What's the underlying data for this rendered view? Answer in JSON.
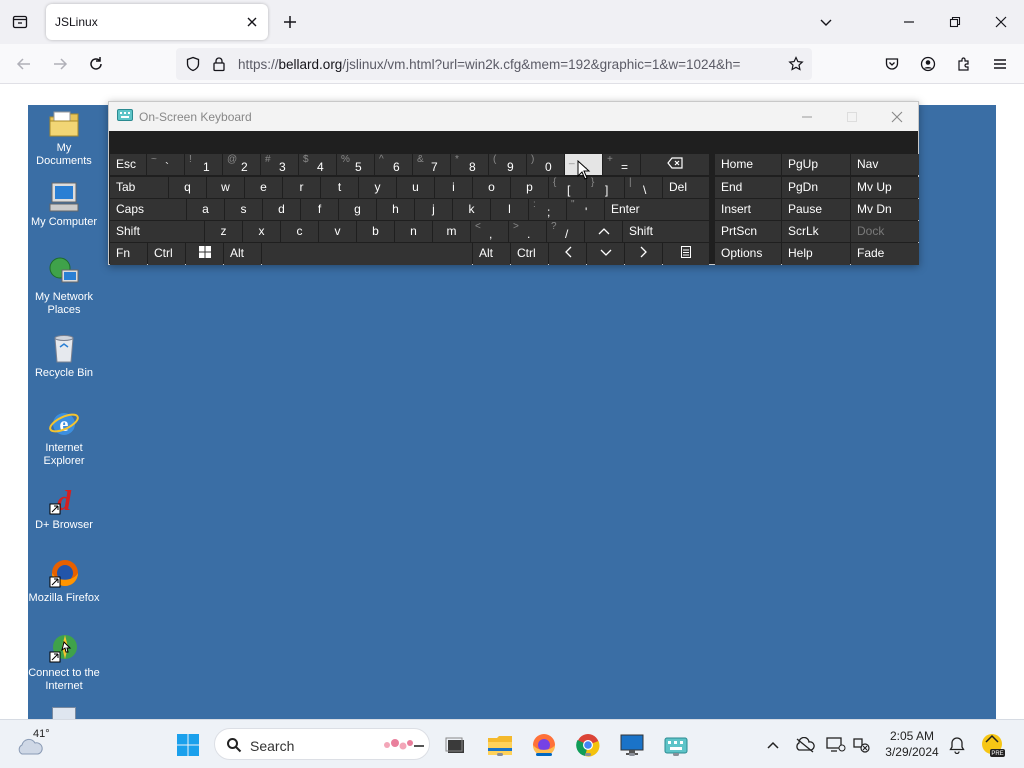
{
  "browser": {
    "tab_title": "JSLinux",
    "url_prefix": "https://",
    "url_domain": "bellard.org",
    "url_rest": "/jslinux/vm.html?url=win2k.cfg&mem=192&graphic=1&w=1024&h="
  },
  "desktop_icons": [
    {
      "label": "My Documents",
      "icon": "folder-documents-icon"
    },
    {
      "label": "My Computer",
      "icon": "computer-icon"
    },
    {
      "label": "My Network Places",
      "icon": "network-icon"
    },
    {
      "label": "Recycle Bin",
      "icon": "recycle-bin-icon"
    },
    {
      "label": "Internet Explorer",
      "icon": "internet-explorer-icon"
    },
    {
      "label": "D+ Browser",
      "icon": "d-plus-icon"
    },
    {
      "label": "Mozilla Firefox",
      "icon": "firefox-icon"
    },
    {
      "label": "Connect to the Internet",
      "icon": "connect-internet-icon"
    }
  ],
  "osk": {
    "title": "On-Screen Keyboard",
    "row1": [
      {
        "s": "~",
        "b": "`"
      },
      {
        "s": "!",
        "b": "1"
      },
      {
        "s": "@",
        "b": "2"
      },
      {
        "s": "#",
        "b": "3"
      },
      {
        "s": "$",
        "b": "4"
      },
      {
        "s": "%",
        "b": "5"
      },
      {
        "s": "^",
        "b": "6"
      },
      {
        "s": "&",
        "b": "7"
      },
      {
        "s": "*",
        "b": "8"
      },
      {
        "s": "(",
        "b": "9"
      },
      {
        "s": ")",
        "b": "0"
      },
      {
        "s": "_",
        "b": "-"
      },
      {
        "s": "+",
        "b": "="
      }
    ],
    "row2": [
      "q",
      "w",
      "e",
      "r",
      "t",
      "y",
      "u",
      "i",
      "o",
      "p"
    ],
    "row2_sym": [
      {
        "s": "{",
        "b": "["
      },
      {
        "s": "}",
        "b": "]"
      },
      {
        "s": "|",
        "b": "\\"
      }
    ],
    "row3": [
      "a",
      "s",
      "d",
      "f",
      "g",
      "h",
      "j",
      "k",
      "l"
    ],
    "row3_sym": [
      {
        "s": ":",
        "b": ";"
      },
      {
        "s": "\"",
        "b": "'"
      }
    ],
    "row4": [
      "z",
      "x",
      "c",
      "v",
      "b",
      "n",
      "m"
    ],
    "row4_sym": [
      {
        "s": "<",
        "b": ","
      },
      {
        "s": ">",
        "b": "."
      },
      {
        "s": "?",
        "b": "/"
      }
    ],
    "labels": {
      "esc": "Esc",
      "tab": "Tab",
      "caps": "Caps",
      "shift": "Shift",
      "shift_r": "Shift",
      "fn": "Fn",
      "ctrl": "Ctrl",
      "alt": "Alt",
      "alt_r": "Alt",
      "ctrl_r": "Ctrl",
      "del": "Del",
      "enter": "Enter"
    },
    "nav": [
      [
        "Home",
        "PgUp",
        "Nav"
      ],
      [
        "End",
        "PgDn",
        "Mv Up"
      ],
      [
        "Insert",
        "Pause",
        "Mv Dn"
      ],
      [
        "PrtScn",
        "ScrLk",
        "Dock"
      ],
      [
        "Options",
        "Help",
        "Fade"
      ]
    ]
  },
  "taskbar": {
    "weather": "41°",
    "search_label": "Search",
    "time": "2:05 AM",
    "date": "3/29/2024"
  },
  "colors": {
    "desktop": "#3a6ea5",
    "key": "#333333",
    "key_highlight": "#e5e5e5",
    "accent": "#0067c0"
  }
}
